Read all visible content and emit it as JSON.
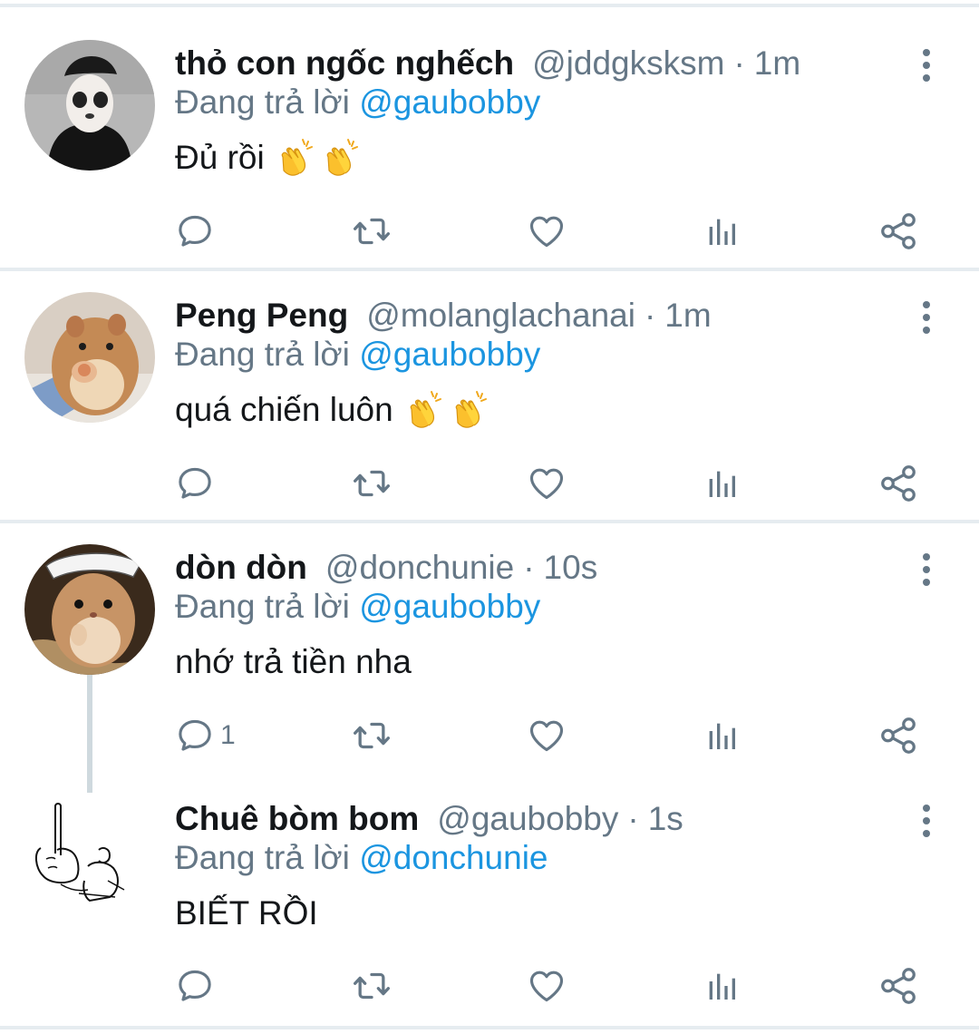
{
  "tweets": [
    {
      "display_name": "thỏ con ngốc nghếch",
      "handle": "@jddgksksm",
      "separator": "·",
      "time": "1m",
      "reply_prefix": "Đang trả lời",
      "reply_to": "@gaubobby",
      "text": "Đủ rồi",
      "emoji": [
        "clapping-hands",
        "clapping-hands"
      ],
      "reply_count": ""
    },
    {
      "display_name": "Peng Peng",
      "handle": "@molanglachanai",
      "separator": "·",
      "time": "1m",
      "reply_prefix": "Đang trả lời",
      "reply_to": "@gaubobby",
      "text": "quá chiến luôn",
      "emoji": [
        "clapping-hands",
        "clapping-hands"
      ],
      "reply_count": ""
    },
    {
      "display_name": "dòn dòn",
      "handle": "@donchunie",
      "separator": "·",
      "time": "10s",
      "reply_prefix": "Đang trả lời",
      "reply_to": "@gaubobby",
      "text": "nhớ trả tiền nha",
      "emoji": [],
      "reply_count": "1"
    },
    {
      "display_name": "Chuê bòm bom",
      "handle": "@gaubobby",
      "separator": "·",
      "time": "1s",
      "reply_prefix": "Đang trả lời",
      "reply_to": "@donchunie",
      "text": "BIẾT RỒI",
      "emoji": [],
      "reply_count": ""
    }
  ],
  "icons": {
    "more": "more-vertical-icon",
    "reply": "reply-bubble-icon",
    "retweet": "retweet-icon",
    "like": "heart-icon",
    "analytics": "analytics-bars-icon",
    "share": "share-icon"
  },
  "colors": {
    "mention": "#1b95e0",
    "secondary_text": "#657786",
    "primary_text": "#14171a",
    "divider": "#e6ecf0",
    "thread_line": "#cfd9de"
  }
}
